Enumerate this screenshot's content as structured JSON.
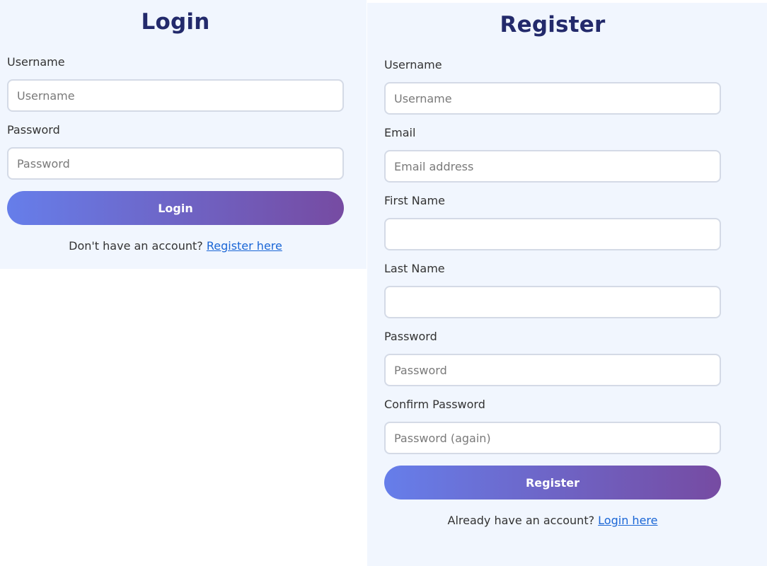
{
  "login": {
    "title": "Login",
    "username_label": "Username",
    "username_placeholder": "Username",
    "username_value": "",
    "password_label": "Password",
    "password_placeholder": "Password",
    "password_value": "",
    "submit_label": "Login",
    "switch_prompt": "Don't have an account? ",
    "switch_link": "Register here"
  },
  "register": {
    "title": "Register",
    "username_label": "Username",
    "username_placeholder": "Username",
    "email_label": "Email",
    "email_placeholder": "Email address",
    "first_name_label": "First Name",
    "first_name_placeholder": "",
    "last_name_label": "Last Name",
    "last_name_placeholder": "",
    "password_label": "Password",
    "password_placeholder": "Password",
    "confirm_password_label": "Confirm Password",
    "confirm_password_placeholder": "Password (again)",
    "submit_label": "Register",
    "switch_prompt": "Already have an account? ",
    "switch_link": "Login here"
  },
  "colors": {
    "panel_background": "#f1f6fe",
    "title_color": "#232a6b",
    "button_gradient_start": "#667eea",
    "button_gradient_end": "#764ba2",
    "link_color": "#1a66d6",
    "input_border": "#d4dae6"
  }
}
